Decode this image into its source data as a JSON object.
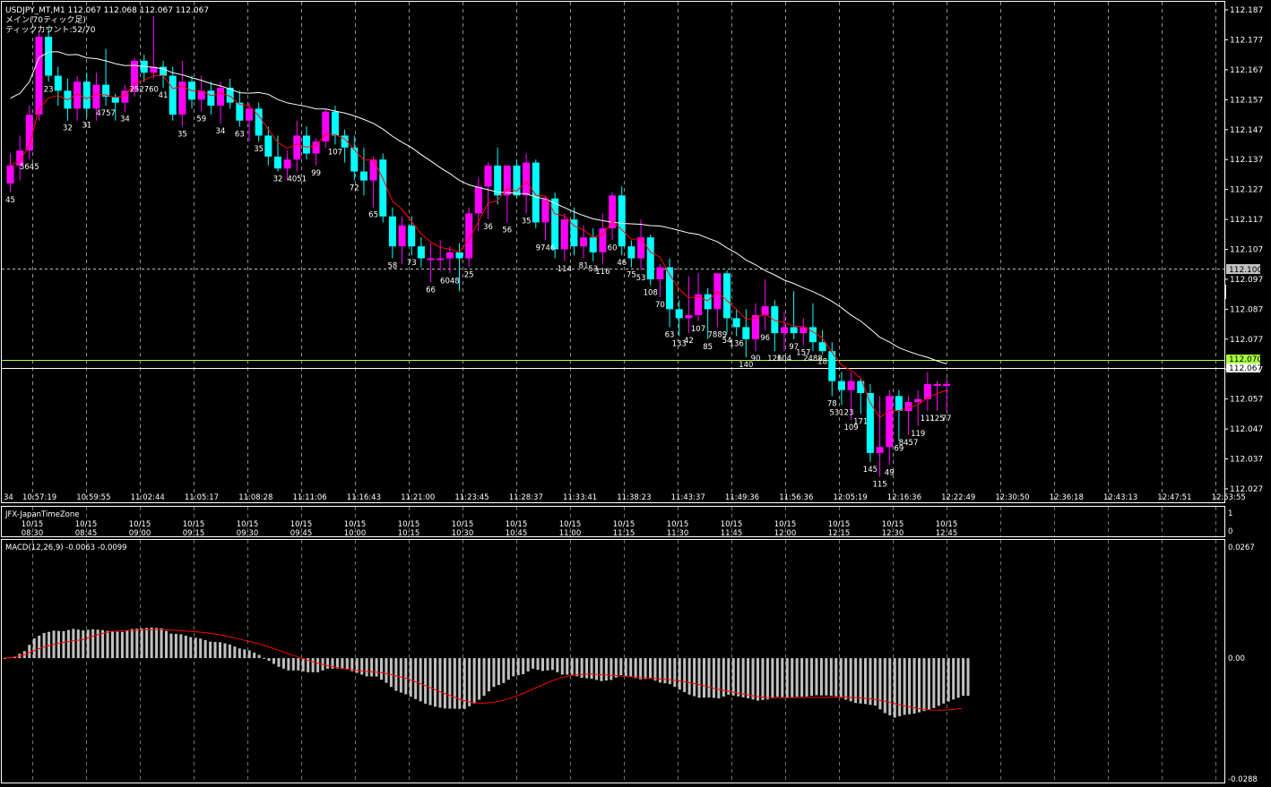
{
  "header": {
    "symbol_line": "USDJPY_MT,M1  112.067 112.068 112.067 112.067",
    "mode_line": "メイン(70ティック足)",
    "tick_line": "ティックカウント:52/70"
  },
  "price_scale": {
    "labels": [
      "112.187",
      "112.177",
      "112.167",
      "112.157",
      "112.147",
      "112.137",
      "112.127",
      "112.117",
      "112.107",
      "112.097",
      "112.087",
      "112.077",
      "112.067",
      "112.057",
      "112.047",
      "112.037",
      "112.027"
    ],
    "tag_ask": "112.100",
    "tag_green": "112.070",
    "tag_bid": "112.067"
  },
  "time_axis": [
    "34",
    "10:57:19",
    "10:59:55",
    "11:02:44",
    "11:05:17",
    "11:08:28",
    "11:11:06",
    "11:16:43",
    "11:21:00",
    "11:23:45",
    "11:28:37",
    "11:33:41",
    "11:38:23",
    "11:43:37",
    "11:49:36",
    "11:56:36",
    "12:05:19",
    "12:16:36",
    "12:22:49",
    "12:30:50",
    "12:36:18",
    "12:43:13",
    "12:47:51",
    "12:53:55"
  ],
  "jfx": {
    "title": "JFX-JapanTimeZone",
    "scale_top": "1",
    "scale_bottom": "0",
    "dates": [
      "10/15",
      "10/15",
      "10/15",
      "10/15",
      "10/15",
      "10/15",
      "10/15",
      "10/15",
      "10/15",
      "10/15",
      "10/15",
      "10/15",
      "10/15",
      "10/15",
      "10/15",
      "10/15",
      "10/15",
      "10/15"
    ],
    "times": [
      "08:30",
      "08:45",
      "09:00",
      "09:15",
      "09:30",
      "09:45",
      "10:00",
      "10:15",
      "10:30",
      "10:45",
      "11:00",
      "11:15",
      "11:30",
      "11:45",
      "12:00",
      "12:15",
      "12:30",
      "12:45"
    ]
  },
  "macd": {
    "title": "MACD(12,26,9) -0.0063 -0.0099",
    "scale": [
      "0.0267",
      "0.00",
      "-0.0288"
    ]
  },
  "colors": {
    "bull": "#ff00ff",
    "bear": "#00ffff",
    "ma_slow": "#ffffff",
    "ma_fast": "#ff0000",
    "grid": "#c0c0c0",
    "hist": "#c0c0c0",
    "signal": "#ff0000",
    "green_line": "#a8ff40"
  },
  "chart_data": [
    {
      "type": "candlestick",
      "title": "USDJPY_MT,M1",
      "ylim": [
        112.027,
        112.187
      ],
      "candles": [
        [
          112.129,
          112.139,
          112.126,
          112.135
        ],
        [
          112.135,
          112.145,
          112.13,
          112.14
        ],
        [
          112.14,
          112.155,
          112.137,
          112.152
        ],
        [
          112.152,
          112.18,
          112.15,
          112.178
        ],
        [
          112.178,
          112.181,
          112.163,
          112.165
        ],
        [
          112.165,
          112.168,
          112.155,
          112.16
        ],
        [
          112.16,
          112.164,
          112.15,
          112.154
        ],
        [
          112.154,
          112.165,
          112.15,
          112.163
        ],
        [
          112.163,
          112.166,
          112.151,
          112.154
        ],
        [
          112.154,
          112.166,
          112.15,
          112.162
        ],
        [
          112.162,
          112.174,
          112.155,
          112.158
        ],
        [
          112.158,
          112.159,
          112.15,
          112.156
        ],
        [
          112.156,
          112.162,
          112.153,
          112.16
        ],
        [
          112.16,
          112.171,
          112.158,
          112.17
        ],
        [
          112.17,
          112.172,
          112.163,
          112.166
        ],
        [
          112.166,
          112.185,
          112.164,
          112.168
        ],
        [
          112.168,
          112.17,
          112.161,
          112.165
        ],
        [
          112.165,
          112.168,
          112.15,
          112.152
        ],
        [
          112.152,
          112.17,
          112.148,
          112.163
        ],
        [
          112.163,
          112.165,
          112.154,
          112.157
        ],
        [
          112.157,
          112.165,
          112.153,
          112.16
        ],
        [
          112.16,
          112.163,
          112.152,
          112.155
        ],
        [
          112.155,
          112.163,
          112.149,
          112.161
        ],
        [
          112.161,
          112.164,
          112.154,
          112.156
        ],
        [
          112.156,
          112.16,
          112.148,
          112.15
        ],
        [
          112.15,
          112.156,
          112.143,
          112.154
        ],
        [
          112.154,
          112.156,
          112.143,
          112.145
        ],
        [
          112.145,
          112.148,
          112.135,
          112.138
        ],
        [
          112.138,
          112.145,
          112.133,
          112.134
        ],
        [
          112.134,
          112.14,
          112.13,
          112.137
        ],
        [
          112.137,
          112.15,
          112.133,
          112.145
        ],
        [
          112.145,
          112.148,
          112.137,
          112.139
        ],
        [
          112.139,
          112.144,
          112.135,
          112.143
        ],
        [
          112.143,
          112.154,
          112.141,
          112.153
        ],
        [
          112.153,
          112.155,
          112.142,
          112.145
        ],
        [
          112.145,
          112.147,
          112.136,
          112.141
        ],
        [
          112.141,
          112.145,
          112.13,
          112.133
        ],
        [
          112.133,
          112.141,
          112.125,
          112.13
        ],
        [
          112.13,
          112.138,
          112.121,
          112.137
        ],
        [
          112.137,
          112.139,
          112.116,
          112.118
        ],
        [
          112.118,
          112.121,
          112.104,
          112.108
        ],
        [
          112.108,
          112.118,
          112.102,
          112.115
        ],
        [
          112.115,
          112.118,
          112.105,
          112.108
        ],
        [
          112.108,
          112.111,
          112.101,
          112.104
        ],
        [
          112.104,
          112.109,
          112.096,
          112.104
        ],
        [
          112.104,
          112.11,
          112.1,
          112.104
        ],
        [
          112.104,
          112.108,
          112.099,
          112.106
        ],
        [
          112.106,
          112.109,
          112.093,
          112.104
        ],
        [
          112.104,
          112.121,
          112.101,
          112.119
        ],
        [
          112.119,
          112.131,
          112.113,
          112.128
        ],
        [
          112.128,
          112.136,
          112.117,
          112.135
        ],
        [
          112.135,
          112.141,
          112.122,
          112.125
        ],
        [
          112.125,
          112.134,
          112.116,
          112.135
        ],
        [
          112.135,
          112.137,
          112.124,
          112.125
        ],
        [
          112.125,
          112.139,
          112.119,
          112.136
        ],
        [
          112.136,
          112.137,
          112.114,
          112.116
        ],
        [
          112.116,
          112.125,
          112.11,
          112.124
        ],
        [
          112.124,
          112.126,
          112.104,
          112.107
        ],
        [
          112.107,
          112.119,
          112.103,
          112.117
        ],
        [
          112.117,
          112.121,
          112.105,
          112.108
        ],
        [
          112.108,
          112.115,
          112.104,
          112.111
        ],
        [
          112.111,
          112.114,
          112.103,
          112.106
        ],
        [
          112.106,
          112.119,
          112.102,
          112.114
        ],
        [
          112.114,
          112.126,
          112.11,
          112.125
        ],
        [
          112.125,
          112.128,
          112.105,
          112.108
        ],
        [
          112.108,
          112.11,
          112.101,
          112.104
        ],
        [
          112.104,
          112.117,
          112.1,
          112.111
        ],
        [
          112.111,
          112.112,
          112.095,
          112.097
        ],
        [
          112.097,
          112.102,
          112.091,
          112.101
        ],
        [
          112.101,
          112.104,
          112.081,
          112.087
        ],
        [
          112.087,
          112.09,
          112.078,
          112.084
        ],
        [
          112.084,
          112.098,
          112.079,
          112.085
        ],
        [
          112.085,
          112.099,
          112.083,
          112.092
        ],
        [
          112.092,
          112.094,
          112.077,
          112.087
        ],
        [
          112.087,
          112.099,
          112.081,
          112.099
        ],
        [
          112.099,
          112.1,
          112.079,
          112.084
        ],
        [
          112.084,
          112.087,
          112.078,
          112.081
        ],
        [
          112.081,
          112.087,
          112.071,
          112.077
        ],
        [
          112.077,
          112.089,
          112.073,
          112.085
        ],
        [
          112.085,
          112.097,
          112.08,
          112.088
        ],
        [
          112.088,
          112.09,
          112.073,
          112.079
        ],
        [
          112.079,
          112.086,
          112.073,
          112.081
        ],
        [
          112.081,
          112.093,
          112.077,
          112.079
        ],
        [
          112.079,
          112.084,
          112.075,
          112.081
        ],
        [
          112.081,
          112.089,
          112.073,
          112.076
        ],
        [
          112.076,
          112.08,
          112.072,
          112.073
        ],
        [
          112.073,
          112.076,
          112.058,
          112.063
        ],
        [
          112.063,
          112.066,
          112.055,
          112.06
        ],
        [
          112.06,
          112.066,
          112.05,
          112.063
        ],
        [
          112.063,
          112.064,
          112.052,
          112.059
        ],
        [
          112.059,
          112.062,
          112.036,
          112.039
        ],
        [
          112.039,
          112.058,
          112.031,
          112.041
        ],
        [
          112.041,
          112.06,
          112.035,
          112.058
        ],
        [
          112.058,
          112.06,
          112.043,
          112.053
        ],
        [
          112.053,
          112.058,
          112.045,
          112.056
        ],
        [
          112.056,
          112.06,
          112.048,
          112.057
        ],
        [
          112.057,
          112.066,
          112.053,
          112.062
        ],
        [
          112.062,
          112.063,
          112.053,
          112.062
        ],
        [
          112.062,
          112.064,
          112.053,
          112.062
        ]
      ]
    },
    {
      "type": "bar",
      "title": "MACD(12,26,9) -0.0063 -0.0099",
      "ylim": [
        -0.0288,
        0.0267
      ]
    }
  ]
}
